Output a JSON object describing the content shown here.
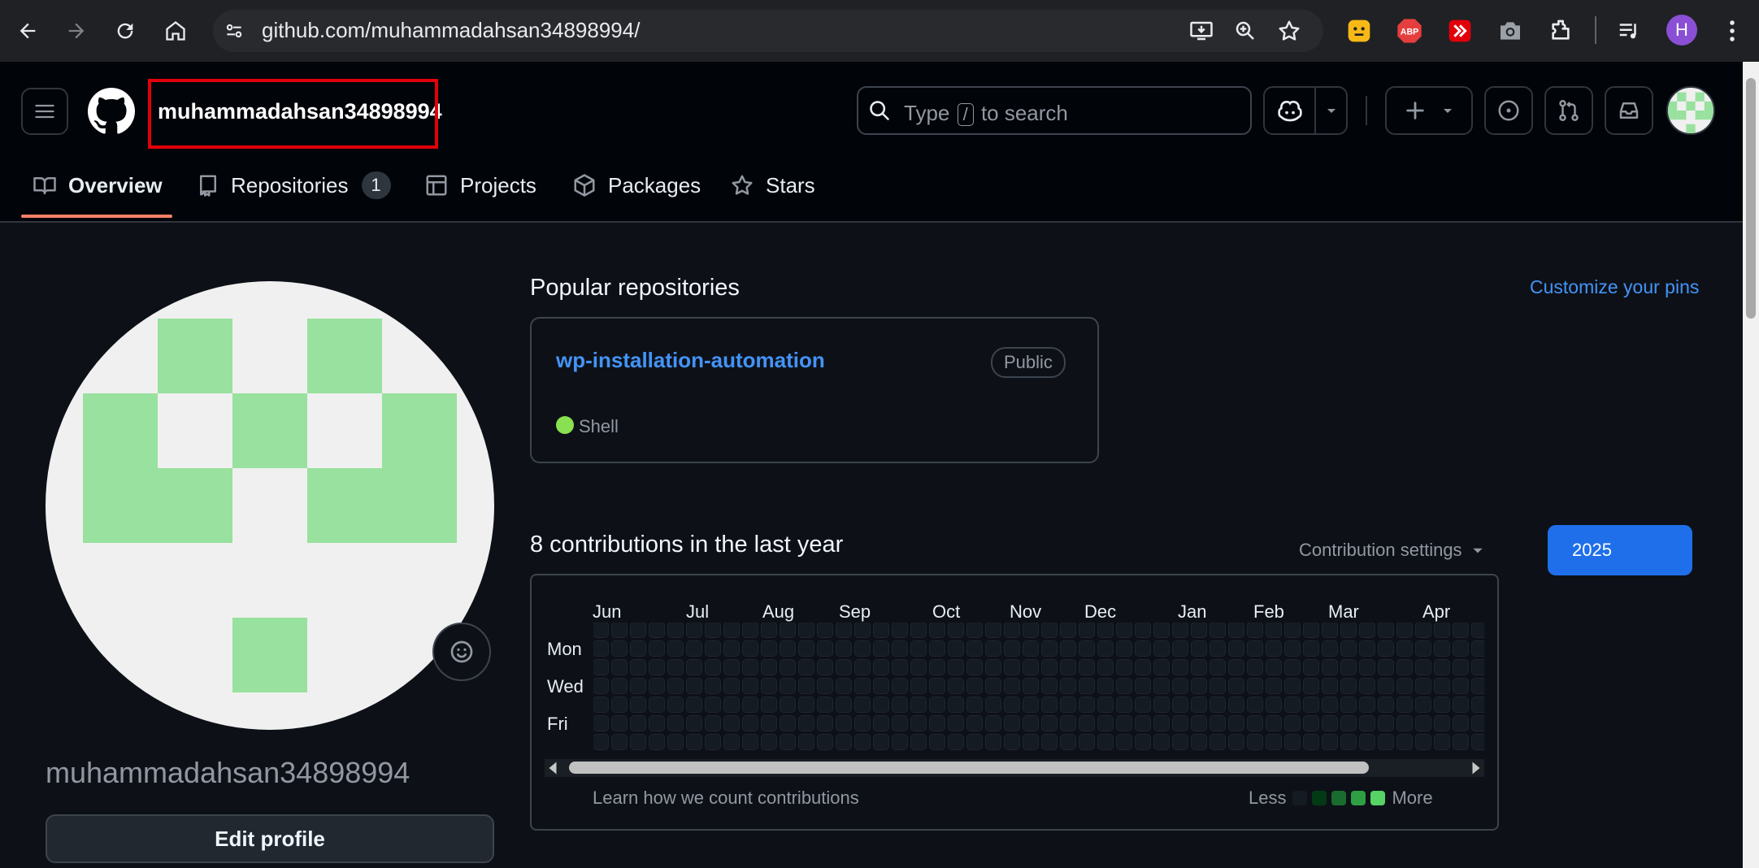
{
  "browser": {
    "url": "github.com/muhammadahsan34898994/",
    "profile_initial": "H",
    "icons": [
      "back-icon",
      "forward-icon",
      "reload-icon",
      "home-icon",
      "site-info-icon",
      "install-icon",
      "zoom-icon",
      "bookmark-star-icon",
      "honey-extension-icon",
      "adblock-plus-icon",
      "screencast-extension-icon",
      "camera-extension-icon",
      "extensions-puzzle-icon",
      "media-queue-icon",
      "kebab-menu-icon"
    ],
    "abp_label": "ABP"
  },
  "header": {
    "username": "muhammadahsan34898994",
    "search": {
      "prefix": "Type ",
      "key": "/",
      "suffix": " to search"
    },
    "icons": [
      "hamburger-menu-icon",
      "github-logo-icon",
      "copilot-icon",
      "plus-icon",
      "issues-icon",
      "pull-requests-icon",
      "inbox-icon"
    ]
  },
  "tabs": [
    {
      "label": "Overview",
      "icon": "book-icon",
      "selected": true
    },
    {
      "label": "Repositories",
      "icon": "repo-icon",
      "count": "1"
    },
    {
      "label": "Projects",
      "icon": "table-icon"
    },
    {
      "label": "Packages",
      "icon": "package-icon"
    },
    {
      "label": "Stars",
      "icon": "star-icon"
    }
  ],
  "profile": {
    "login": "muhammadahsan34898994",
    "edit_label": "Edit profile"
  },
  "popular": {
    "heading": "Popular repositories",
    "customize_label": "Customize your pins",
    "repos": [
      {
        "name": "wp-installation-automation",
        "visibility": "Public",
        "language": "Shell",
        "language_color": "#89e051"
      }
    ]
  },
  "contributions": {
    "heading": "8 contributions in the last year",
    "settings_label": "Contribution settings",
    "year": "2025",
    "months": [
      "Jun",
      "Jul",
      "Aug",
      "Sep",
      "Oct",
      "Nov",
      "Dec",
      "Jan",
      "Feb",
      "Mar",
      "Apr"
    ],
    "days": [
      "Mon",
      "Wed",
      "Fri"
    ],
    "learn_label": "Learn how we count contributions",
    "legend_less": "Less",
    "legend_more": "More",
    "legend_colors": [
      "#151b23",
      "#033a16",
      "#196c2e",
      "#2ea043",
      "#56d364"
    ]
  },
  "colors": {
    "accent": "#1f6feb",
    "link": "#4493f8",
    "tab_underline": "#f78166",
    "highlight": "#e1000a",
    "avatar_green": "#98e19e"
  }
}
